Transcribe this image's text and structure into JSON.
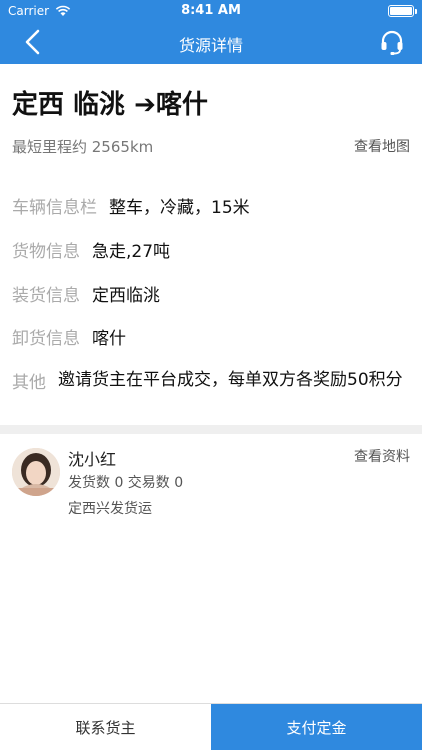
{
  "status_bar": {
    "carrier": "Carrier",
    "time": "8:41 AM"
  },
  "nav": {
    "title": "货源详情"
  },
  "route": {
    "title": "定西 临洮 ➔喀什",
    "distance": "最短里程约 2565km",
    "map_link": "查看地图"
  },
  "info": [
    {
      "label": "车辆信息栏",
      "value": "整车，冷藏，15米"
    },
    {
      "label": "货物信息",
      "value": "急走,27吨"
    },
    {
      "label": "装货信息",
      "value": "定西临洮"
    },
    {
      "label": "卸货信息",
      "value": "喀什"
    },
    {
      "label": "其他",
      "value": "邀请货主在平台成交，每单双方各奖励50积分"
    }
  ],
  "shipper": {
    "name": "沈小红",
    "stats": "发货数 0 交易数 0",
    "company": "定西兴发货运",
    "profile_link": "查看资料"
  },
  "actions": {
    "contact": "联系货主",
    "pay": "支付定金"
  },
  "colors": {
    "primary": "#2f89df"
  }
}
